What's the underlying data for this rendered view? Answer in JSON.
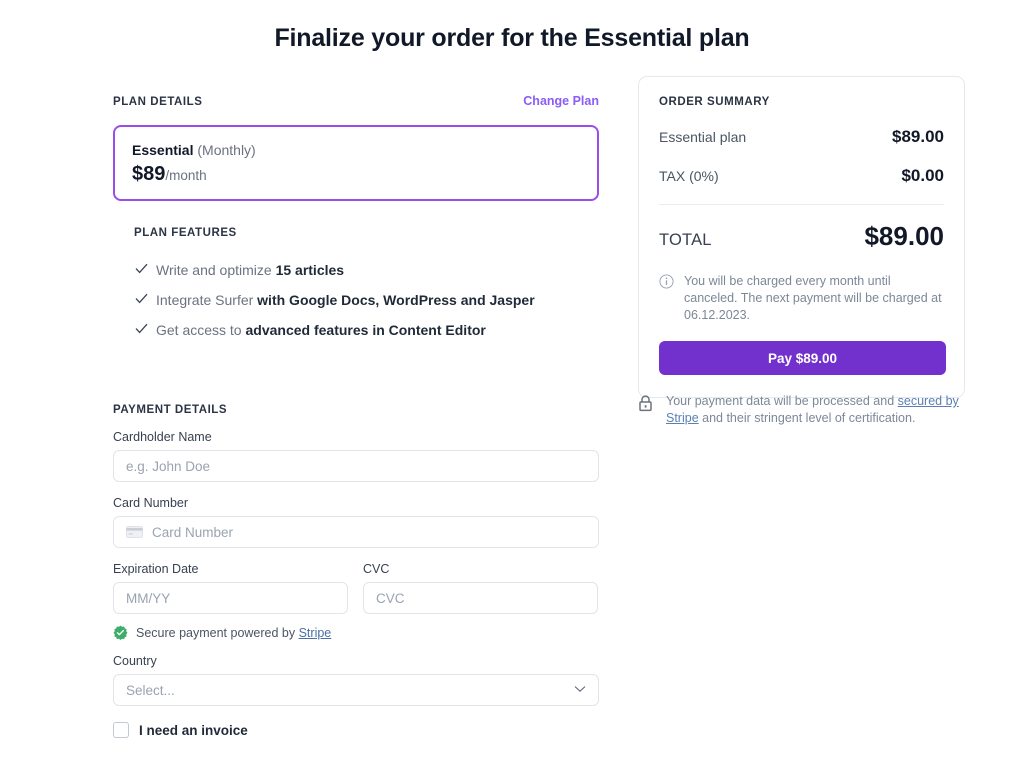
{
  "page": {
    "title": "Finalize your order for the Essential plan"
  },
  "plan_details": {
    "section_label": "PLAN DETAILS",
    "change_plan_label": "Change Plan",
    "plan_name": "Essential",
    "plan_billing_period": "(Monthly)",
    "plan_price": "$89",
    "plan_price_suffix": "/month",
    "features_label": "PLAN FEATURES",
    "features": [
      {
        "prefix": "Write and optimize ",
        "emphasis": "15 articles",
        "suffix": ""
      },
      {
        "prefix": "Integrate Surfer ",
        "emphasis": "with Google Docs, WordPress and Jasper",
        "suffix": ""
      },
      {
        "prefix": "Get access to ",
        "emphasis": "advanced features in Content Editor",
        "suffix": ""
      }
    ]
  },
  "payment_details": {
    "section_label": "PAYMENT DETAILS",
    "cardholder_label": "Cardholder Name",
    "cardholder_placeholder": "e.g. John Doe",
    "card_number_label": "Card Number",
    "card_number_placeholder": "Card Number",
    "expiration_label": "Expiration Date",
    "expiration_placeholder": "MM/YY",
    "cvc_label": "CVC",
    "cvc_placeholder": "CVC",
    "stripe_note_prefix": "Secure payment powered by ",
    "stripe_note_link": "Stripe",
    "country_label": "Country",
    "country_value": "Select...",
    "invoice_checkbox_label": "I need an invoice"
  },
  "order_summary": {
    "title": "ORDER SUMMARY",
    "rows": [
      {
        "label": "Essential plan",
        "value": "$89.00"
      },
      {
        "label": "TAX (0%)",
        "value": "$0.00"
      }
    ],
    "total_label": "TOTAL",
    "total_value": "$89.00",
    "charge_note": "You will be charged every month until canceled. The next payment will be charged at 06.12.2023.",
    "pay_button_label": "Pay $89.00"
  },
  "secure_note": {
    "text_before": "Your payment data will be processed and ",
    "link": "secured by Stripe",
    "text_after": " and their stringent level of certification."
  },
  "colors": {
    "accent_purple": "#7231cc",
    "plan_border_purple": "#9b4dea",
    "link_purple": "#8b5cf6",
    "stripe_green": "#3dae6a"
  }
}
